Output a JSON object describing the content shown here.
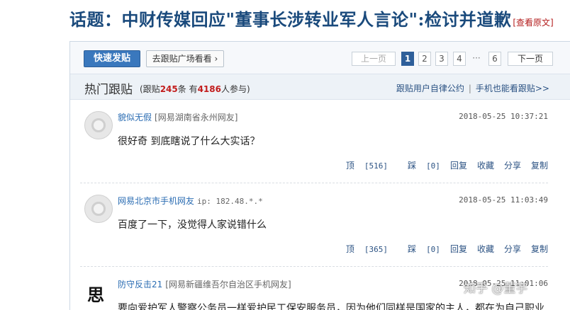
{
  "header": {
    "topic_title": "话题：中财传媒回应\"董事长涉转业军人言论\":检讨并道歉",
    "view_original": "[查看原文]"
  },
  "toolbar": {
    "quick_post_label": "快速发贴",
    "plaza_label": "去跟贴广场看看",
    "pagination": {
      "prev_label": "上一页",
      "pages": [
        "1",
        "2",
        "3",
        "4"
      ],
      "current_page": "1",
      "ellipsis": "···",
      "last_page": "6",
      "next_label": "下一页"
    }
  },
  "hot": {
    "title": "热门跟贴",
    "stats_prefix": "(跟贴",
    "count": "245",
    "stats_mid": "条 有",
    "participants": "4186",
    "stats_suffix": "人参与)",
    "link_rules": "跟贴用户自律公约",
    "link_separator": "|",
    "link_mobile": "手机也能看跟贴>>"
  },
  "comments": [
    {
      "username": "貌似无假",
      "location": "[网易湖南省永州网友]",
      "ip": "",
      "time": "2018-05-25 10:37:21",
      "text": "很好奇  到底瞎说了什么大实话？",
      "up_label": "顶",
      "up_count": "[516]",
      "down_label": "踩",
      "down_count": "[0]",
      "reply_label": "回复",
      "fav_label": "收藏",
      "share_label": "分享",
      "copy_label": "复制"
    },
    {
      "username": "网易北京市手机网友",
      "location": "",
      "ip": "ip: 182.48.*.*",
      "time": "2018-05-25 11:03:49",
      "text": "百度了一下，没觉得人家说错什么",
      "up_label": "顶",
      "up_count": "[365]",
      "down_label": "踩",
      "down_count": "[0]",
      "reply_label": "回复",
      "fav_label": "收藏",
      "share_label": "分享",
      "copy_label": "复制"
    },
    {
      "username": "防守反击21",
      "location": "[网易新疆维吾尔自治区手机网友]",
      "ip": "",
      "time": "2018-05-25 11:01:06",
      "avatar_glyph": "思",
      "text": "要向爱护军人警察公务员一样爱护民工保安服务员，因为他们同样是国家的主人，都在为自己职业"
    }
  ],
  "watermark": "知乎 @董宇"
}
